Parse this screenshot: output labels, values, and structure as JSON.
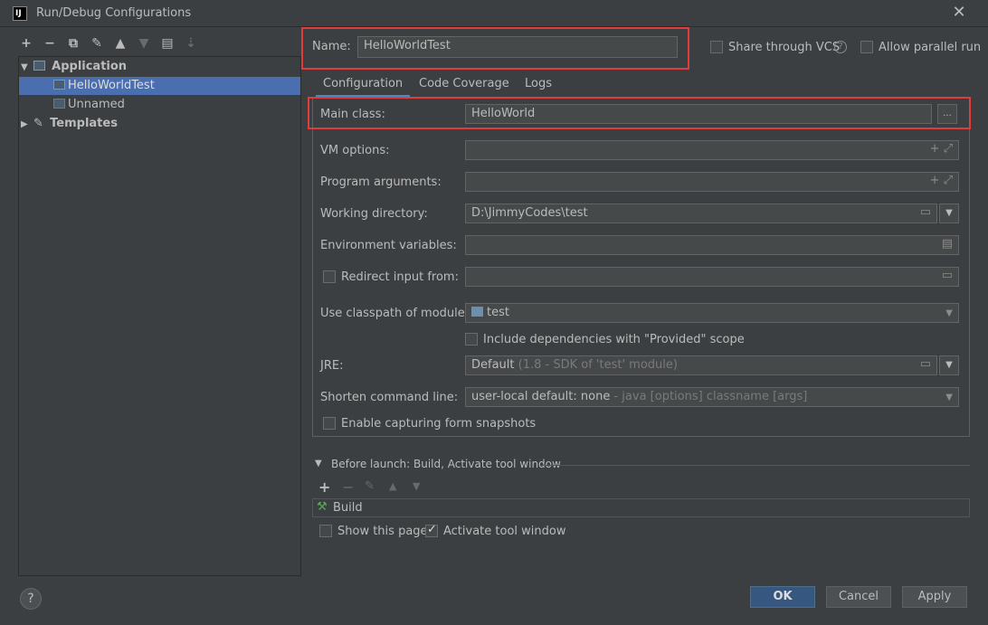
{
  "window": {
    "title": "Run/Debug Configurations",
    "app_icon_text": "IJ"
  },
  "toolbar": {
    "add": "+",
    "remove": "−",
    "copy": "⧉",
    "edit": "🔧",
    "up": "▲",
    "down": "▼",
    "folder": "📁",
    "sort": "↓a"
  },
  "tree": {
    "application": "Application",
    "items": [
      "HelloWorldTest",
      "Unnamed"
    ],
    "templates": "Templates"
  },
  "header": {
    "name_label": "Name:",
    "name_value": "HelloWorldTest",
    "share_vcs": "Share through VCS",
    "allow_parallel": "Allow parallel run"
  },
  "tabs": [
    "Configuration",
    "Code Coverage",
    "Logs"
  ],
  "form": {
    "main_class_label": "Main class:",
    "main_class_value": "HelloWorld",
    "browse": "...",
    "vm_options_label": "VM options:",
    "program_args_label": "Program arguments:",
    "working_dir_label": "Working directory:",
    "working_dir_value": "D:\\JimmyCodes\\test",
    "env_vars_label": "Environment variables:",
    "redirect_label": "Redirect input from:",
    "classpath_label": "Use classpath of module:",
    "classpath_value": "test",
    "include_deps": "Include dependencies with \"Provided\" scope",
    "jre_label": "JRE:",
    "jre_value": "Default",
    "jre_detail": "(1.8 - SDK of 'test' module)",
    "shorten_label": "Shorten command line:",
    "shorten_value": "user-local default: none",
    "shorten_detail": "- java [options] classname [args]",
    "capture_snapshots": "Enable capturing form snapshots"
  },
  "before_launch": {
    "title": "Before launch: Build, Activate tool window",
    "build_item": "Build",
    "show_page": "Show this page",
    "activate_tool": "Activate tool window"
  },
  "buttons": {
    "ok": "OK",
    "cancel": "Cancel",
    "apply": "Apply",
    "help": "?"
  }
}
